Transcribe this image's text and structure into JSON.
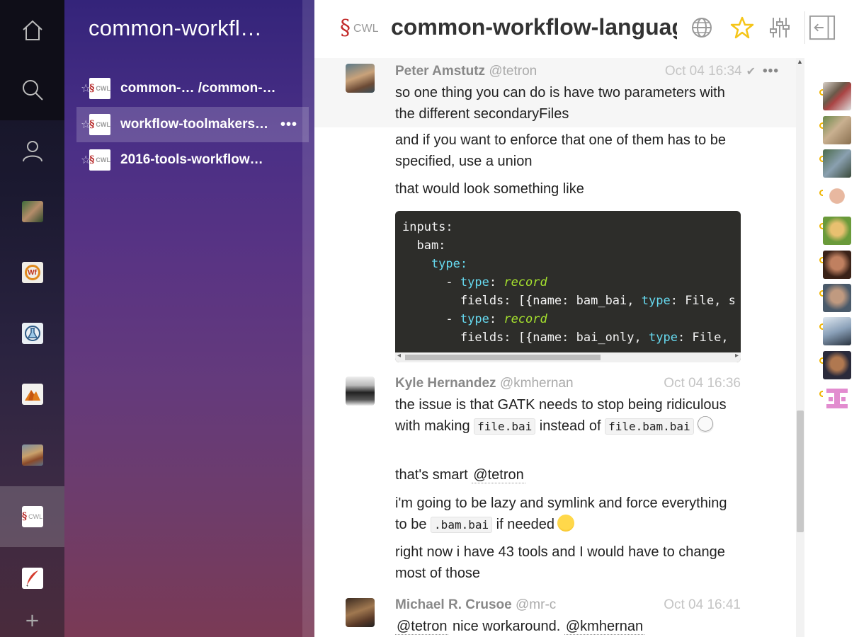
{
  "app": {
    "group_title": "common-workfl…",
    "room_title": "common-workflow-language/",
    "room_logo_text": "CWL"
  },
  "rail": {
    "items": [
      "home",
      "search",
      "people",
      "user-avatar",
      "wf-room",
      "flask-room",
      "mountain-room",
      "photo-room",
      "cwl-room",
      "quill-room"
    ],
    "add_label": "+"
  },
  "rooms": [
    {
      "name": "common-… /common-…",
      "logo": "CWL"
    },
    {
      "name": "workflow-toolmakers…",
      "logo": "CWL",
      "selected": true,
      "more": "•••"
    },
    {
      "name": "2016-tools-workflow…",
      "logo": "CWL"
    }
  ],
  "colors": {
    "accent_star": "#f5c518",
    "cwl_red": "#c22a2a",
    "status_dot": "#f0b400"
  },
  "messages": [
    {
      "name": "Peter Amstutz",
      "username": "@tetron",
      "time": "Oct 04 16:34",
      "check": "✔",
      "dots": "•••",
      "lines": [
        "so one thing you can do is have two parameters with the different secondaryFiles",
        "and if you want to enforce that one of them has to be specified, use a union",
        "that would look something like"
      ],
      "code": [
        "inputs:",
        "  bam:",
        "    type:",
        "      - type: record",
        "        fields: [{name: bam_bai, type: File, s",
        "      - type: record",
        "        fields: [{name: bai_only, type: File,"
      ]
    },
    {
      "name": "Kyle Hernandez",
      "username": "@kmhernan",
      "time": "Oct 04 16:36",
      "t1_a": "the issue is that GATK needs to stop being ridiculous with making ",
      "t1_code1": "file.bai",
      "t1_b": " instead of ",
      "t1_code2": "file.bam.bai",
      "t2_a": "that's smart ",
      "t2_mention": "@tetron",
      "t3_a": "i'm going to be lazy and symlink and force everything to be ",
      "t3_code": ".bam.bai",
      "t3_b": " if needed",
      "t4": "right now i have 43 tools and I would have to change most of those"
    },
    {
      "name": "Michael R. Crusoe",
      "username": "@mr-c",
      "time": "Oct 04 16:41",
      "m1": "@tetron",
      "mid": " nice workaround. ",
      "m2": "@kmhernan"
    }
  ],
  "people_count": 10
}
